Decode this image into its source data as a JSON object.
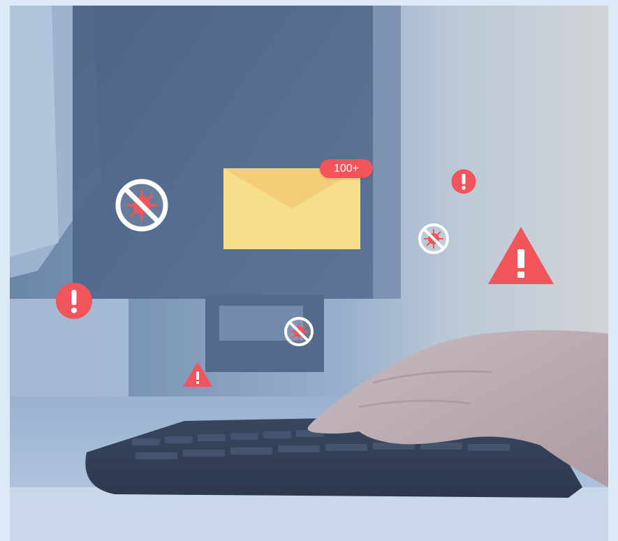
{
  "notification": {
    "count_label": "100+"
  },
  "colors": {
    "alert_red": "#f2545b",
    "envelope_yellow": "#f6de8a",
    "envelope_flap": "#f4cd78",
    "frame_border": "#dce9f7"
  },
  "icons": [
    "envelope-icon",
    "virus-blocked-icon",
    "exclamation-circle-icon",
    "warning-triangle-icon"
  ]
}
